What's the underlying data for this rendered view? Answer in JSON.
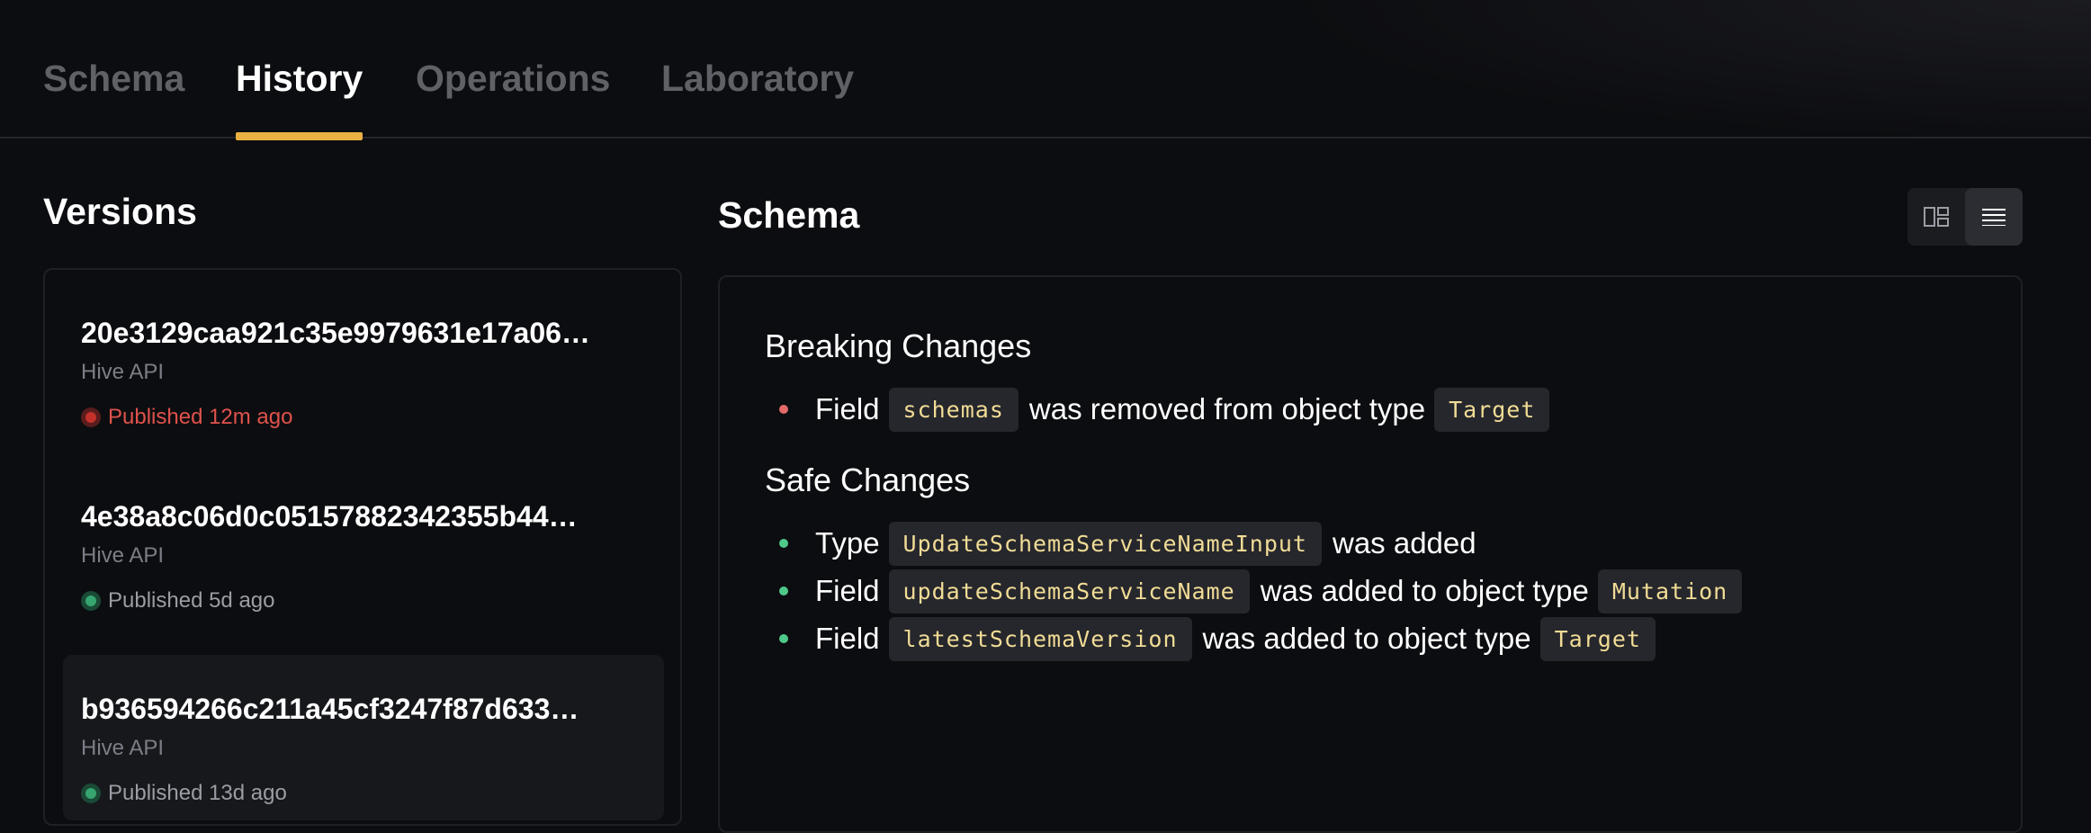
{
  "tabs": [
    {
      "label": "Schema",
      "active": false
    },
    {
      "label": "History",
      "active": true
    },
    {
      "label": "Operations",
      "active": false
    },
    {
      "label": "Laboratory",
      "active": false
    }
  ],
  "versions": {
    "title": "Versions",
    "items": [
      {
        "hash": "20e3129caa921c35e9979631e17a06…",
        "service": "Hive API",
        "status": "Published 12m ago",
        "state": "error"
      },
      {
        "hash": "4e38a8c06d0c05157882342355b44…",
        "service": "Hive API",
        "status": "Published 5d ago",
        "state": "success"
      },
      {
        "hash": "b936594266c211a45cf3247f87d633…",
        "service": "Hive API",
        "status": "Published 13d ago",
        "state": "success",
        "selected": true
      }
    ]
  },
  "schema": {
    "title": "Schema",
    "view_toggle": {
      "options": [
        "split-view-icon",
        "list-view-icon"
      ],
      "active": "list-view-icon"
    },
    "breaking": {
      "title": "Breaking Changes",
      "items": [
        {
          "w1": "Field",
          "c1": "schemas",
          "w2": "was removed from object type",
          "c2": "Target"
        }
      ]
    },
    "safe": {
      "title": "Safe Changes",
      "items": [
        {
          "w1": "Type",
          "c1": "UpdateSchemaServiceNameInput",
          "w2": "was added"
        },
        {
          "w1": "Field",
          "c1": "updateSchemaServiceName",
          "w2": "was added to object type",
          "c2": "Mutation"
        },
        {
          "w1": "Field",
          "c1": "latestSchemaVersion",
          "w2": "was added to object type",
          "c2": "Target"
        }
      ]
    }
  },
  "colors": {
    "accent": "#eab042",
    "error": "#e0524c",
    "success": "#37a56f",
    "code_text": "#f1dc96"
  }
}
